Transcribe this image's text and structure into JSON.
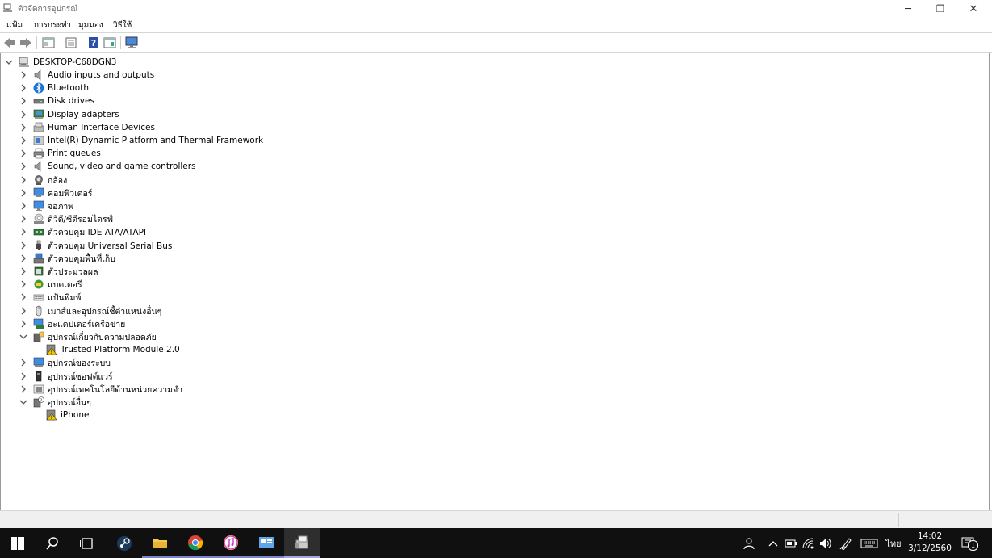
{
  "window": {
    "title": "ตัวจัดการอุปกรณ์",
    "minimize": "─",
    "restore": "❐",
    "close": "✕"
  },
  "menu": [
    "แฟ้ม",
    "การกระทำ",
    "มุมมอง",
    "วิธีใช้"
  ],
  "tree": {
    "root": "DESKTOP-C68DGN3",
    "items": [
      {
        "label": "Audio inputs and outputs",
        "icon": "speaker-icon",
        "expanded": false
      },
      {
        "label": "Bluetooth",
        "icon": "bluetooth-icon",
        "expanded": false
      },
      {
        "label": "Disk drives",
        "icon": "disk-drive-icon",
        "expanded": false
      },
      {
        "label": "Display adapters",
        "icon": "display-adapter-icon",
        "expanded": false
      },
      {
        "label": "Human Interface Devices",
        "icon": "hid-icon",
        "expanded": false
      },
      {
        "label": "Intel(R) Dynamic Platform and Thermal Framework",
        "icon": "chip-icon",
        "expanded": false
      },
      {
        "label": "Print queues",
        "icon": "printer-icon",
        "expanded": false
      },
      {
        "label": "Sound, video and game controllers",
        "icon": "speaker-icon",
        "expanded": false
      },
      {
        "label": "กล้อง",
        "icon": "camera-icon",
        "expanded": false
      },
      {
        "label": "คอมพิวเตอร์",
        "icon": "computer-icon",
        "expanded": false
      },
      {
        "label": "จอภาพ",
        "icon": "monitor-icon",
        "expanded": false
      },
      {
        "label": "ดีวีดี/ซีดีรอมไดรฟ์",
        "icon": "dvd-drive-icon",
        "expanded": false
      },
      {
        "label": "ตัวควบคุม IDE ATA/ATAPI",
        "icon": "ide-controller-icon",
        "expanded": false
      },
      {
        "label": "ตัวควบคุม Universal Serial Bus",
        "icon": "usb-icon",
        "expanded": false
      },
      {
        "label": "ตัวควบคุมพื้นที่เก็บ",
        "icon": "storage-controller-icon",
        "expanded": false
      },
      {
        "label": "ตัวประมวลผล",
        "icon": "processor-icon",
        "expanded": false
      },
      {
        "label": "แบตเตอรี่",
        "icon": "battery-icon",
        "expanded": false
      },
      {
        "label": "แป้นพิมพ์",
        "icon": "keyboard-icon",
        "expanded": false
      },
      {
        "label": "เมาส์และอุปกรณ์ชี้ตำแหน่งอื่นๆ",
        "icon": "mouse-icon",
        "expanded": false
      },
      {
        "label": "อะแดปเตอร์เครือข่าย",
        "icon": "network-adapter-icon",
        "expanded": false
      },
      {
        "label": "อุปกรณ์เกี่ยวกับความปลอดภัย",
        "icon": "security-device-icon",
        "expanded": true,
        "children": [
          {
            "label": "Trusted Platform Module 2.0",
            "icon": "warning-device-icon"
          }
        ]
      },
      {
        "label": "อุปกรณ์ของระบบ",
        "icon": "system-device-icon",
        "expanded": false
      },
      {
        "label": "อุปกรณ์ซอฟต์แวร์",
        "icon": "software-device-icon",
        "expanded": false
      },
      {
        "label": "อุปกรณ์เทคโนโลยีด้านหน่วยความจำ",
        "icon": "memory-device-icon",
        "expanded": false
      },
      {
        "label": "อุปกรณ์อื่นๆ",
        "icon": "other-device-icon",
        "expanded": true,
        "children": [
          {
            "label": "iPhone",
            "icon": "warning-device-icon"
          }
        ]
      }
    ]
  },
  "taskbar": {
    "apps": [
      "start-icon",
      "search-icon",
      "task-view-icon",
      "steam-icon",
      "file-explorer-icon",
      "chrome-icon",
      "itunes-icon",
      "control-panel-icon",
      "device-manager-icon"
    ],
    "language": "ไทย",
    "time": "14:02",
    "date": "3/12/2560",
    "notification_count": "1"
  }
}
